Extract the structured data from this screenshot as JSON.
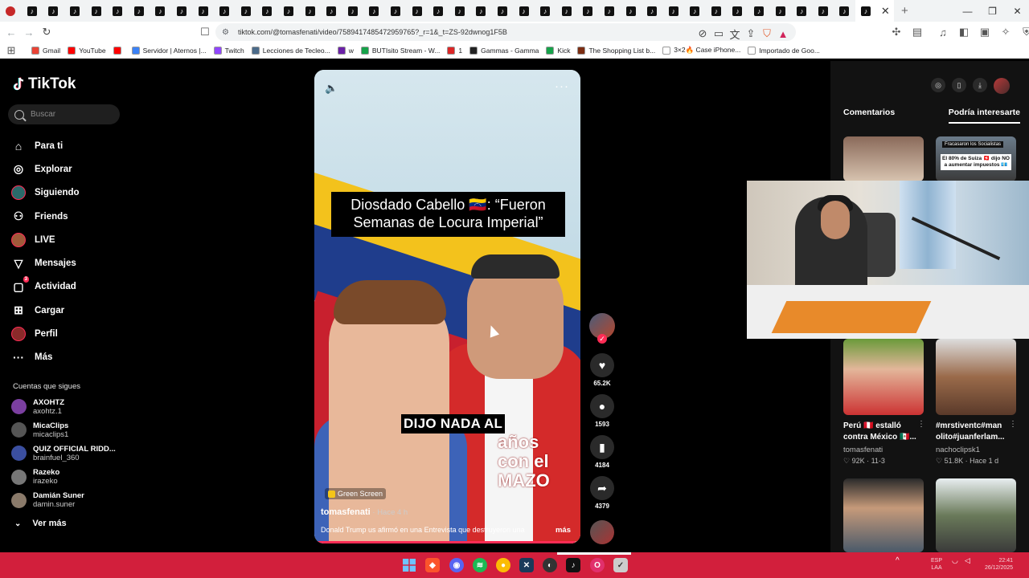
{
  "browser": {
    "tab_count": 41,
    "tab_icon": "tiktok-icon",
    "close_tab": "✕",
    "new_tab": "+",
    "url": "tiktok.com/@tomasfenati/video/7589417485472959765?_r=1&_t=ZS-92dwnog1F5B",
    "window_controls": [
      "—",
      "❐",
      "✕"
    ]
  },
  "bookmarks": [
    {
      "label": "Gmail",
      "color": "#ea4335"
    },
    {
      "label": "YouTube",
      "color": "#ff0000"
    },
    {
      "label": "",
      "color": "#ff0000"
    },
    {
      "label": "Servidor | Aternos |...",
      "color": "#3b82f6"
    },
    {
      "label": "Twitch",
      "color": "#9146ff"
    },
    {
      "label": "Lecciones de Tecleo...",
      "color": "#4b6b8a"
    },
    {
      "label": "w",
      "color": "#6b21a8"
    },
    {
      "label": "BUTIsito Stream - W...",
      "color": "#16a34a"
    },
    {
      "label": "1",
      "color": "#dc2626"
    },
    {
      "label": "Gammas - Gamma",
      "color": "#222222"
    },
    {
      "label": "Kick",
      "color": "#16a34a"
    },
    {
      "label": "The Shopping List b...",
      "color": "#7c2d12"
    },
    {
      "label": "3×2🔥 Case iPhone...",
      "color": "#ffffff"
    },
    {
      "label": "Importado de Goo...",
      "color": "#ffffff"
    }
  ],
  "tiktok": {
    "logo": "TikTok",
    "search_placeholder": "Buscar",
    "nav": [
      {
        "label": "Para ti",
        "icon": "home-icon",
        "glyph": "⌂"
      },
      {
        "label": "Explorar",
        "icon": "compass-icon",
        "glyph": "◎"
      },
      {
        "label": "Siguiendo",
        "icon": "following-avatar-icon",
        "glyph": ""
      },
      {
        "label": "Friends",
        "icon": "friends-icon",
        "glyph": "⚇"
      },
      {
        "label": "LIVE",
        "icon": "live-avatar-icon",
        "glyph": ""
      },
      {
        "label": "Mensajes",
        "icon": "messages-icon",
        "glyph": "▽"
      },
      {
        "label": "Actividad",
        "icon": "activity-icon",
        "glyph": "▢",
        "badge": "3"
      },
      {
        "label": "Cargar",
        "icon": "upload-icon",
        "glyph": "⊞"
      },
      {
        "label": "Perfil",
        "icon": "profile-avatar-icon",
        "glyph": ""
      },
      {
        "label": "Más",
        "icon": "more-icon",
        "glyph": "···"
      }
    ],
    "following_title": "Cuentas que sigues",
    "following": [
      {
        "name": "AXOHTZ",
        "user": "axohtz.1",
        "color": "#7b3fa0"
      },
      {
        "name": "MicaClips",
        "user": "micaclips1",
        "color": "#555555"
      },
      {
        "name": "QUIZ OFFICIAL RIDD...",
        "user": "brainfuel_360",
        "color": "#3b4fa0"
      },
      {
        "name": "Razeko",
        "user": "irazeko",
        "color": "#777777"
      },
      {
        "name": "Damián Suner",
        "user": "damin.suner",
        "color": "#8a7a6a"
      }
    ],
    "see_more": "Ver más"
  },
  "video": {
    "caption": "Diosdado Cabello 🇻🇪: “Fueron Semanas de Locura Imperial”",
    "subtitle": "DIJO NADA AL",
    "jacket_text": "años con el MAZO",
    "effect": "Green Screen",
    "author": "tomasfenati",
    "time": " · Hace 4 h",
    "description": "Donald Trump us afirmó en una Entrevista que destruyeron una",
    "more": "más",
    "progress": 0.98,
    "actions": [
      {
        "name": "like-button",
        "icon": "heart-icon",
        "glyph": "♥",
        "count": "65.2K"
      },
      {
        "name": "comment-button",
        "icon": "comment-icon",
        "glyph": "●",
        "count": "1593"
      },
      {
        "name": "bookmark-button",
        "icon": "bookmark-icon",
        "glyph": "▮",
        "count": "4184"
      },
      {
        "name": "share-button",
        "icon": "share-icon",
        "glyph": "➦",
        "count": "4379"
      }
    ]
  },
  "right_panel": {
    "tabs": [
      "Comentarios",
      "Podría interesarte"
    ],
    "thumb_label_1": "Fracasaron los Socialistas",
    "thumb_label_2": "El 80% de Suiza 🇨🇭 dijo NO a aumentar impuestos 💶",
    "cards": [
      {
        "title1": "Perú 🇵🇪 estalló",
        "title2": "contra México 🇲🇽...",
        "user": "tomasfenati",
        "meta": "♡ 92K · 11-3"
      },
      {
        "title1": "#mrstiventc#man",
        "title2": "olito#juanferlam...",
        "user": "nachoclipsk1",
        "meta": "♡ 51.8K · Hace 1 d"
      }
    ]
  },
  "taskbar": {
    "tray_lang": "ESP\nLAA",
    "clock": "22:41\n26/12/2025"
  }
}
